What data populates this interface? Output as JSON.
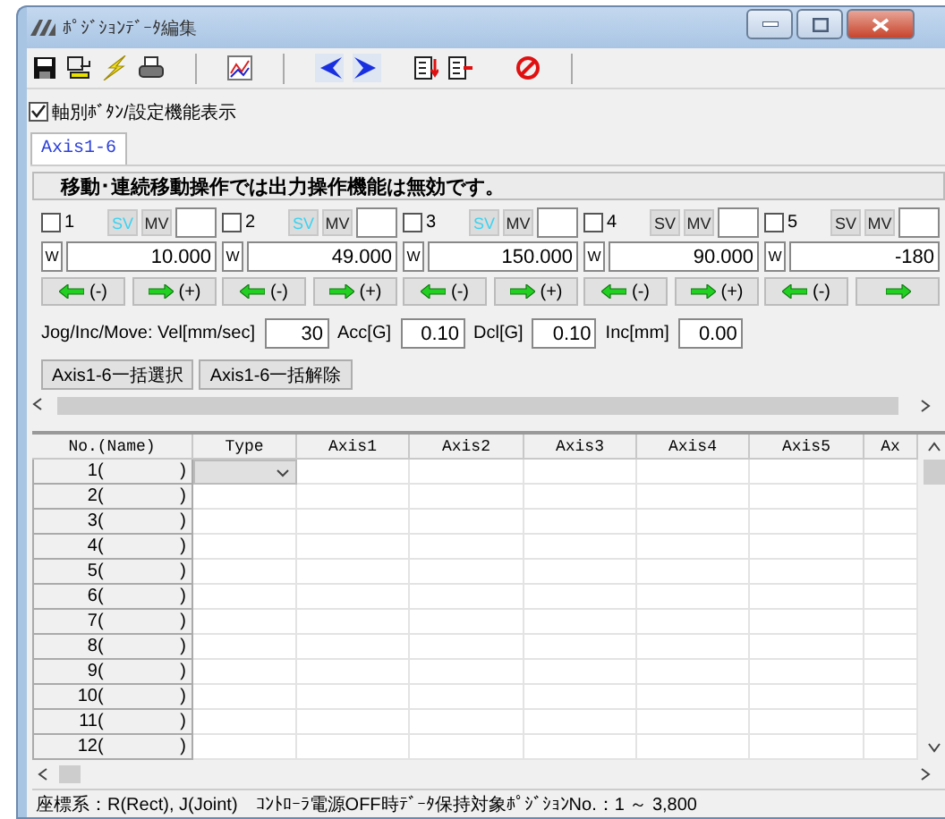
{
  "window": {
    "title": "ﾎﾟｼﾞｼｮﾝﾃﾞｰﾀ編集"
  },
  "show_axis_buttons": {
    "label": "軸別ﾎﾞﾀﾝ/設定機能表示",
    "checked": true
  },
  "tabs": [
    {
      "label": "Axis1-6",
      "selected": true
    }
  ],
  "notice": "移動･連続移動操作では出力操作機能は無効です。",
  "axes": [
    {
      "number": "1",
      "checked": false,
      "sv": "SV",
      "sv_on": true,
      "mv": "MV",
      "unit": "W",
      "value": "10.000",
      "jog": [
        {
          "label": "(-)",
          "kind": "left"
        },
        {
          "label": "(+)",
          "kind": "right"
        }
      ]
    },
    {
      "number": "2",
      "checked": false,
      "sv": "SV",
      "sv_on": true,
      "mv": "MV",
      "unit": "W",
      "value": "49.000",
      "jog": [
        {
          "label": "(-)",
          "kind": "left"
        },
        {
          "label": "(+)",
          "kind": "right"
        }
      ]
    },
    {
      "number": "3",
      "checked": false,
      "sv": "SV",
      "sv_on": true,
      "mv": "MV",
      "unit": "W",
      "value": "150.000",
      "jog": [
        {
          "label": "(-)",
          "kind": "left"
        },
        {
          "label": "(+)",
          "kind": "right"
        }
      ]
    },
    {
      "number": "4",
      "checked": false,
      "sv": "SV",
      "sv_on": false,
      "mv": "MV",
      "unit": "W",
      "value": "90.000",
      "jog": [
        {
          "label": "(-)",
          "kind": "left"
        },
        {
          "label": "(+)",
          "kind": "right"
        }
      ]
    },
    {
      "number": "5",
      "checked": false,
      "sv": "SV",
      "sv_on": false,
      "mv": "MV",
      "unit": "W",
      "value": "-180",
      "jog": [
        {
          "label": "(-)",
          "kind": "left"
        },
        {
          "kind": "right"
        }
      ]
    }
  ],
  "motion": {
    "label": "Jog/Inc/Move: Vel[mm/sec]",
    "vel": "30",
    "fields": [
      {
        "label": "Acc[G]",
        "value": "0.10"
      },
      {
        "label": "Dcl[G]",
        "value": "0.10"
      },
      {
        "label": "Inc[mm]",
        "value": "0.00"
      }
    ]
  },
  "bulk_buttons": [
    "Axis1-6一括選択",
    "Axis1-6一括解除"
  ],
  "table": {
    "columns": [
      "No.(Name)",
      "Type",
      "Axis1",
      "Axis2",
      "Axis3",
      "Axis4",
      "Axis5",
      "Ax"
    ],
    "rows": [
      {
        "no": "1(",
        "close": ")",
        "type_dropdown": true
      },
      {
        "no": "2(",
        "close": ")",
        "type_dropdown": false
      },
      {
        "no": "3(",
        "close": ")",
        "type_dropdown": false
      },
      {
        "no": "4(",
        "close": ")",
        "type_dropdown": false
      },
      {
        "no": "5(",
        "close": ")",
        "type_dropdown": false
      },
      {
        "no": "6(",
        "close": ")",
        "type_dropdown": false
      },
      {
        "no": "7(",
        "close": ")",
        "type_dropdown": false
      },
      {
        "no": "8(",
        "close": ")",
        "type_dropdown": false
      },
      {
        "no": "9(",
        "close": ")",
        "type_dropdown": false
      },
      {
        "no": "10(",
        "close": ")",
        "type_dropdown": false
      },
      {
        "no": "11(",
        "close": ")",
        "type_dropdown": false
      },
      {
        "no": "12(",
        "close": ")",
        "type_dropdown": false
      }
    ]
  },
  "status_bar": [
    "座標系：R(Rect), J(Joint)",
    "ｺﾝﾄﾛｰﾗ電源OFF時ﾃﾞｰﾀ保持対象ﾎﾟｼﾞｼｮﾝNo.：1 ～ 3,800"
  ]
}
